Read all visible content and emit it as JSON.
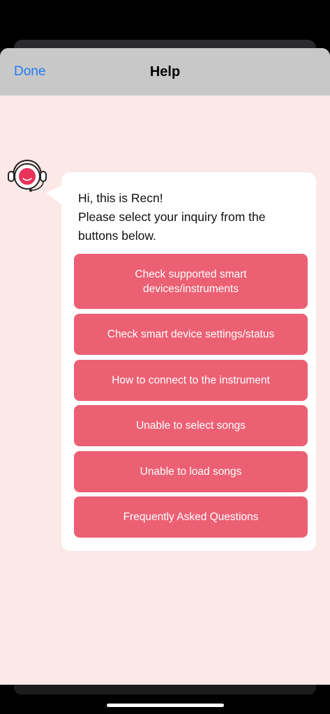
{
  "navbar": {
    "done_label": "Done",
    "title": "Help"
  },
  "chat": {
    "greeting_line1": "Hi, this is Recn!",
    "greeting_line2": "Please select your inquiry from the buttons below.",
    "buttons": [
      {
        "label": "Check supported smart devices/instruments"
      },
      {
        "label": "Check smart device settings/status"
      },
      {
        "label": "How to connect to the instrument"
      },
      {
        "label": "Unable to select songs"
      },
      {
        "label": "Unable to load songs"
      },
      {
        "label": "Frequently Asked Questions"
      }
    ]
  },
  "colors": {
    "accent_button": "#ec6074",
    "background": "#fce8e7",
    "navbar": "#c8c8c8",
    "link": "#1f7cf5"
  },
  "icons": {
    "avatar": "headset-mascot-icon"
  }
}
